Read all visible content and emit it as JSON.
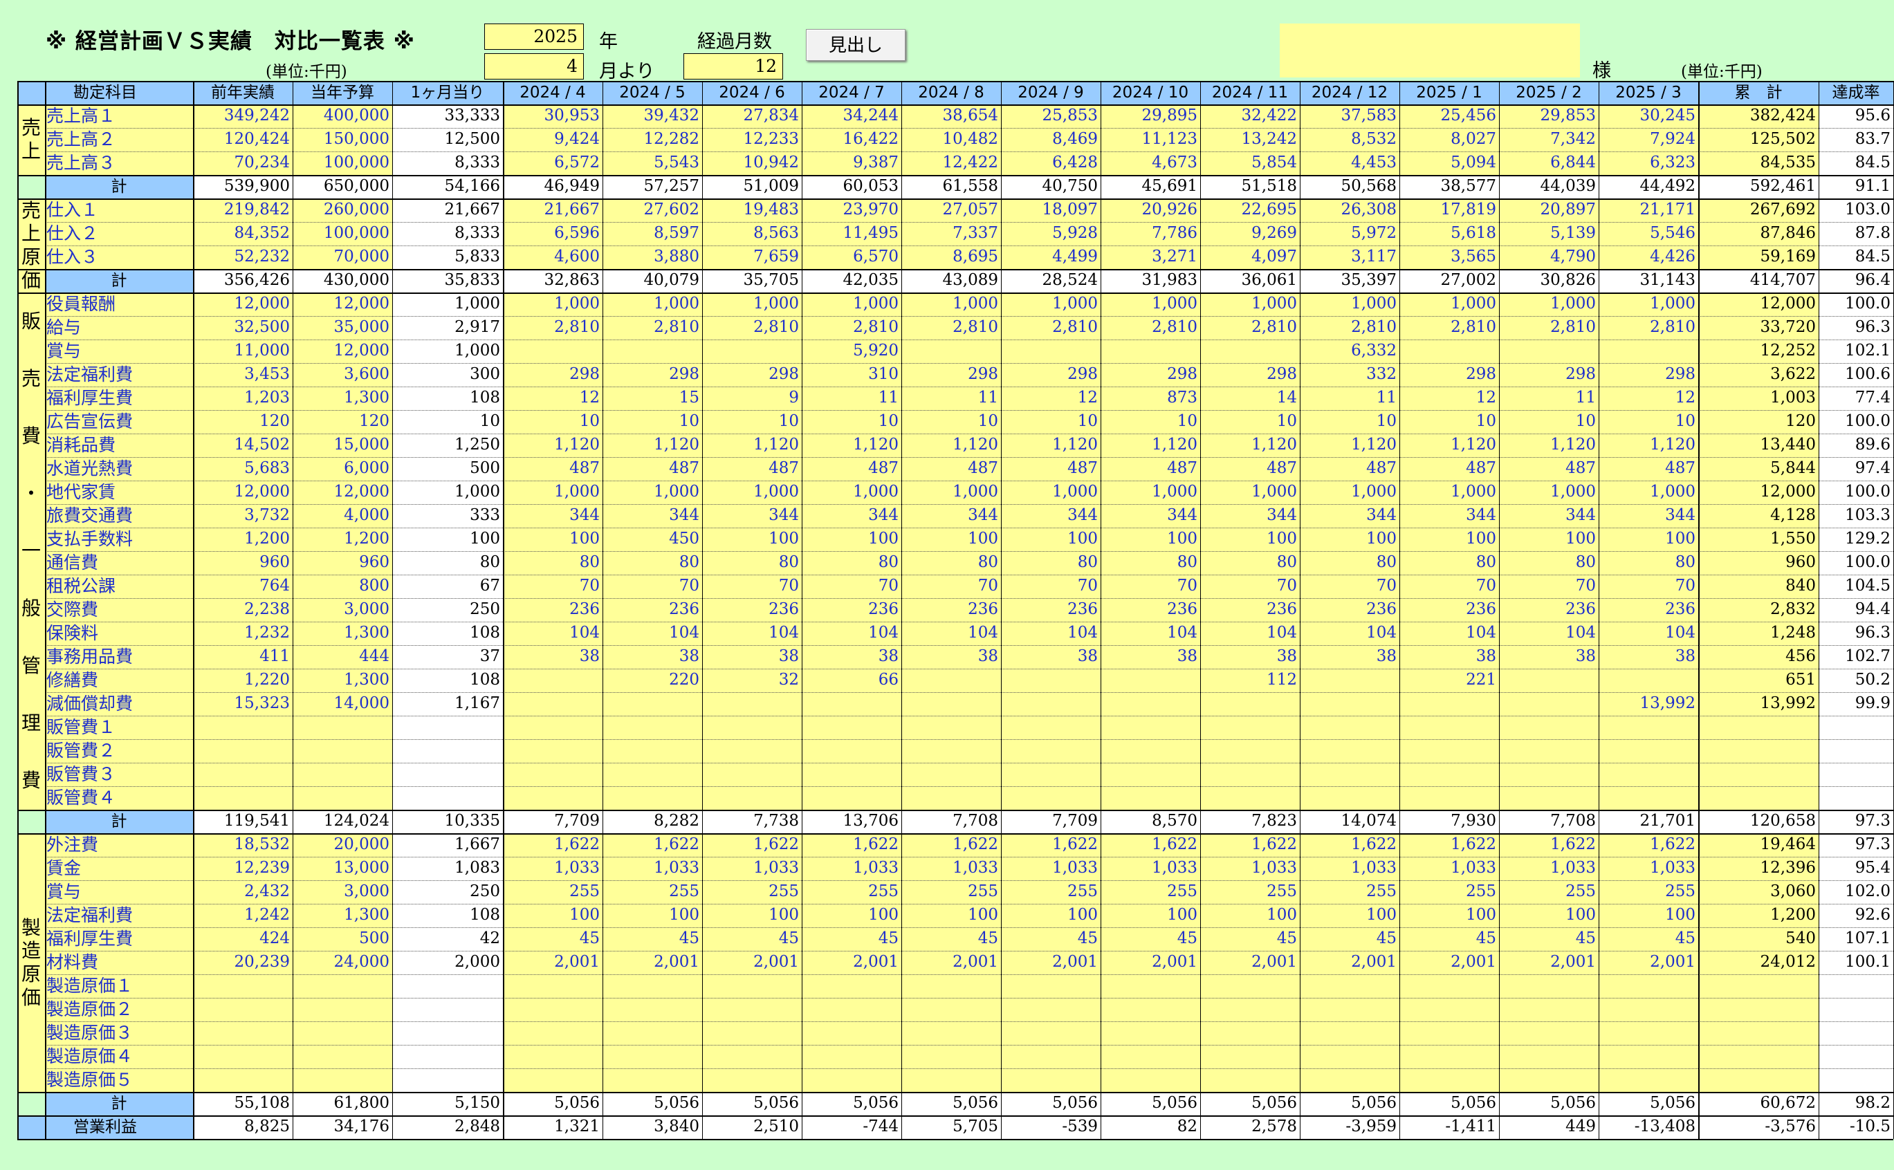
{
  "title": "※ 経営計画ＶＳ実績　対比一覧表 ※",
  "unit_label": "(単位:千円)",
  "controls": {
    "year_value": "2025",
    "year_label": "年",
    "month_value": "4",
    "month_label": "月より",
    "elapsed_label": "経過月数",
    "elapsed_value": "12",
    "heading_button": "見出し"
  },
  "client": {
    "name": "",
    "suffix": "様",
    "unit_label": "(単位:千円)"
  },
  "columns": [
    "勘定科目",
    "前年実績",
    "当年予算",
    "1ヶ月当り",
    "2024 / 4",
    "2024 / 5",
    "2024 / 6",
    "2024 / 7",
    "2024 / 8",
    "2024 / 9",
    "2024 / 10",
    "2024 / 11",
    "2024 / 12",
    "2025 / 1",
    "2025 / 2",
    "2025 / 3",
    "累　計",
    "達成率"
  ],
  "groups": [
    {
      "label": "売上",
      "start": 0,
      "rows": 3
    },
    {
      "label": "売上原価",
      "start": 4,
      "rows": 4
    },
    {
      "label": "販売費・一般管理費",
      "start": 8,
      "rows": 22
    },
    {
      "label": "製造原価",
      "start": 31,
      "rows": 11
    }
  ],
  "rows": [
    {
      "name": "売上高１",
      "vals": [
        "349,242",
        "400,000",
        "33,333",
        "30,953",
        "39,432",
        "27,834",
        "34,244",
        "38,654",
        "25,853",
        "29,895",
        "32,422",
        "37,583",
        "25,456",
        "29,853",
        "30,245",
        "382,424",
        "95.6"
      ]
    },
    {
      "name": "売上高２",
      "vals": [
        "120,424",
        "150,000",
        "12,500",
        "9,424",
        "12,282",
        "12,233",
        "16,422",
        "10,482",
        "8,469",
        "11,123",
        "13,242",
        "8,532",
        "8,027",
        "7,342",
        "7,924",
        "125,502",
        "83.7"
      ]
    },
    {
      "name": "売上高３",
      "vals": [
        "70,234",
        "100,000",
        "8,333",
        "6,572",
        "5,543",
        "10,942",
        "9,387",
        "12,422",
        "6,428",
        "4,673",
        "5,854",
        "4,453",
        "5,094",
        "6,844",
        "6,323",
        "84,535",
        "84.5"
      ]
    },
    {
      "name": "計",
      "total": true,
      "vals": [
        "539,900",
        "650,000",
        "54,166",
        "46,949",
        "57,257",
        "51,009",
        "60,053",
        "61,558",
        "40,750",
        "45,691",
        "51,518",
        "50,568",
        "38,577",
        "44,039",
        "44,492",
        "592,461",
        "91.1"
      ]
    },
    {
      "name": "仕入１",
      "vals": [
        "219,842",
        "260,000",
        "21,667",
        "21,667",
        "27,602",
        "19,483",
        "23,970",
        "27,057",
        "18,097",
        "20,926",
        "22,695",
        "26,308",
        "17,819",
        "20,897",
        "21,171",
        "267,692",
        "103.0"
      ]
    },
    {
      "name": "仕入２",
      "vals": [
        "84,352",
        "100,000",
        "8,333",
        "6,596",
        "8,597",
        "8,563",
        "11,495",
        "7,337",
        "5,928",
        "7,786",
        "9,269",
        "5,972",
        "5,618",
        "5,139",
        "5,546",
        "87,846",
        "87.8"
      ]
    },
    {
      "name": "仕入３",
      "vals": [
        "52,232",
        "70,000",
        "5,833",
        "4,600",
        "3,880",
        "7,659",
        "6,570",
        "8,695",
        "4,499",
        "3,271",
        "4,097",
        "3,117",
        "3,565",
        "4,790",
        "4,426",
        "59,169",
        "84.5"
      ]
    },
    {
      "name": "計",
      "total": true,
      "vals": [
        "356,426",
        "430,000",
        "35,833",
        "32,863",
        "40,079",
        "35,705",
        "42,035",
        "43,089",
        "28,524",
        "31,983",
        "36,061",
        "35,397",
        "27,002",
        "30,826",
        "31,143",
        "414,707",
        "96.4"
      ]
    },
    {
      "name": "役員報酬",
      "vals": [
        "12,000",
        "12,000",
        "1,000",
        "1,000",
        "1,000",
        "1,000",
        "1,000",
        "1,000",
        "1,000",
        "1,000",
        "1,000",
        "1,000",
        "1,000",
        "1,000",
        "1,000",
        "12,000",
        "100.0"
      ]
    },
    {
      "name": "給与",
      "vals": [
        "32,500",
        "35,000",
        "2,917",
        "2,810",
        "2,810",
        "2,810",
        "2,810",
        "2,810",
        "2,810",
        "2,810",
        "2,810",
        "2,810",
        "2,810",
        "2,810",
        "2,810",
        "33,720",
        "96.3"
      ]
    },
    {
      "name": "賞与",
      "vals": [
        "11,000",
        "12,000",
        "1,000",
        "",
        "",
        "",
        "5,920",
        "",
        "",
        "",
        "",
        "6,332",
        "",
        "",
        "",
        "12,252",
        "102.1"
      ]
    },
    {
      "name": "法定福利費",
      "vals": [
        "3,453",
        "3,600",
        "300",
        "298",
        "298",
        "298",
        "310",
        "298",
        "298",
        "298",
        "298",
        "332",
        "298",
        "298",
        "298",
        "3,622",
        "100.6"
      ]
    },
    {
      "name": "福利厚生費",
      "vals": [
        "1,203",
        "1,300",
        "108",
        "12",
        "15",
        "9",
        "11",
        "11",
        "12",
        "873",
        "14",
        "11",
        "12",
        "11",
        "12",
        "1,003",
        "77.4"
      ]
    },
    {
      "name": "広告宣伝費",
      "vals": [
        "120",
        "120",
        "10",
        "10",
        "10",
        "10",
        "10",
        "10",
        "10",
        "10",
        "10",
        "10",
        "10",
        "10",
        "10",
        "120",
        "100.0"
      ]
    },
    {
      "name": "消耗品費",
      "vals": [
        "14,502",
        "15,000",
        "1,250",
        "1,120",
        "1,120",
        "1,120",
        "1,120",
        "1,120",
        "1,120",
        "1,120",
        "1,120",
        "1,120",
        "1,120",
        "1,120",
        "1,120",
        "13,440",
        "89.6"
      ]
    },
    {
      "name": "水道光熱費",
      "vals": [
        "5,683",
        "6,000",
        "500",
        "487",
        "487",
        "487",
        "487",
        "487",
        "487",
        "487",
        "487",
        "487",
        "487",
        "487",
        "487",
        "5,844",
        "97.4"
      ]
    },
    {
      "name": "地代家賃",
      "vals": [
        "12,000",
        "12,000",
        "1,000",
        "1,000",
        "1,000",
        "1,000",
        "1,000",
        "1,000",
        "1,000",
        "1,000",
        "1,000",
        "1,000",
        "1,000",
        "1,000",
        "1,000",
        "12,000",
        "100.0"
      ]
    },
    {
      "name": "旅費交通費",
      "vals": [
        "3,732",
        "4,000",
        "333",
        "344",
        "344",
        "344",
        "344",
        "344",
        "344",
        "344",
        "344",
        "344",
        "344",
        "344",
        "344",
        "4,128",
        "103.3"
      ]
    },
    {
      "name": "支払手数料",
      "vals": [
        "1,200",
        "1,200",
        "100",
        "100",
        "450",
        "100",
        "100",
        "100",
        "100",
        "100",
        "100",
        "100",
        "100",
        "100",
        "100",
        "1,550",
        "129.2"
      ]
    },
    {
      "name": "通信費",
      "vals": [
        "960",
        "960",
        "80",
        "80",
        "80",
        "80",
        "80",
        "80",
        "80",
        "80",
        "80",
        "80",
        "80",
        "80",
        "80",
        "960",
        "100.0"
      ]
    },
    {
      "name": "租税公課",
      "vals": [
        "764",
        "800",
        "67",
        "70",
        "70",
        "70",
        "70",
        "70",
        "70",
        "70",
        "70",
        "70",
        "70",
        "70",
        "70",
        "840",
        "104.5"
      ]
    },
    {
      "name": "交際費",
      "vals": [
        "2,238",
        "3,000",
        "250",
        "236",
        "236",
        "236",
        "236",
        "236",
        "236",
        "236",
        "236",
        "236",
        "236",
        "236",
        "236",
        "2,832",
        "94.4"
      ]
    },
    {
      "name": "保険料",
      "vals": [
        "1,232",
        "1,300",
        "108",
        "104",
        "104",
        "104",
        "104",
        "104",
        "104",
        "104",
        "104",
        "104",
        "104",
        "104",
        "104",
        "1,248",
        "96.3"
      ]
    },
    {
      "name": "事務用品費",
      "vals": [
        "411",
        "444",
        "37",
        "38",
        "38",
        "38",
        "38",
        "38",
        "38",
        "38",
        "38",
        "38",
        "38",
        "38",
        "38",
        "456",
        "102.7"
      ]
    },
    {
      "name": "修繕費",
      "vals": [
        "1,220",
        "1,300",
        "108",
        "",
        "220",
        "32",
        "66",
        "",
        "",
        "",
        "112",
        "",
        "221",
        "",
        "",
        "651",
        "50.2"
      ]
    },
    {
      "name": "減価償却費",
      "vals": [
        "15,323",
        "14,000",
        "1,167",
        "",
        "",
        "",
        "",
        "",
        "",
        "",
        "",
        "",
        "",
        "",
        "13,992",
        "13,992",
        "99.9"
      ]
    },
    {
      "name": "販管費１",
      "vals": [
        "",
        "",
        "",
        "",
        "",
        "",
        "",
        "",
        "",
        "",
        "",
        "",
        "",
        "",
        "",
        "",
        ""
      ]
    },
    {
      "name": "販管費２",
      "vals": [
        "",
        "",
        "",
        "",
        "",
        "",
        "",
        "",
        "",
        "",
        "",
        "",
        "",
        "",
        "",
        "",
        ""
      ]
    },
    {
      "name": "販管費３",
      "vals": [
        "",
        "",
        "",
        "",
        "",
        "",
        "",
        "",
        "",
        "",
        "",
        "",
        "",
        "",
        "",
        "",
        ""
      ]
    },
    {
      "name": "販管費４",
      "vals": [
        "",
        "",
        "",
        "",
        "",
        "",
        "",
        "",
        "",
        "",
        "",
        "",
        "",
        "",
        "",
        "",
        ""
      ]
    },
    {
      "name": "計",
      "total": true,
      "vals": [
        "119,541",
        "124,024",
        "10,335",
        "7,709",
        "8,282",
        "7,738",
        "13,706",
        "7,708",
        "7,709",
        "8,570",
        "7,823",
        "14,074",
        "7,930",
        "7,708",
        "21,701",
        "120,658",
        "97.3"
      ]
    },
    {
      "name": "外注費",
      "vals": [
        "18,532",
        "20,000",
        "1,667",
        "1,622",
        "1,622",
        "1,622",
        "1,622",
        "1,622",
        "1,622",
        "1,622",
        "1,622",
        "1,622",
        "1,622",
        "1,622",
        "1,622",
        "19,464",
        "97.3"
      ]
    },
    {
      "name": "賃金",
      "vals": [
        "12,239",
        "13,000",
        "1,083",
        "1,033",
        "1,033",
        "1,033",
        "1,033",
        "1,033",
        "1,033",
        "1,033",
        "1,033",
        "1,033",
        "1,033",
        "1,033",
        "1,033",
        "12,396",
        "95.4"
      ]
    },
    {
      "name": "賞与",
      "vals": [
        "2,432",
        "3,000",
        "250",
        "255",
        "255",
        "255",
        "255",
        "255",
        "255",
        "255",
        "255",
        "255",
        "255",
        "255",
        "255",
        "3,060",
        "102.0"
      ]
    },
    {
      "name": "法定福利費",
      "vals": [
        "1,242",
        "1,300",
        "108",
        "100",
        "100",
        "100",
        "100",
        "100",
        "100",
        "100",
        "100",
        "100",
        "100",
        "100",
        "100",
        "1,200",
        "92.6"
      ]
    },
    {
      "name": "福利厚生費",
      "vals": [
        "424",
        "500",
        "42",
        "45",
        "45",
        "45",
        "45",
        "45",
        "45",
        "45",
        "45",
        "45",
        "45",
        "45",
        "45",
        "540",
        "107.1"
      ]
    },
    {
      "name": "材料費",
      "vals": [
        "20,239",
        "24,000",
        "2,000",
        "2,001",
        "2,001",
        "2,001",
        "2,001",
        "2,001",
        "2,001",
        "2,001",
        "2,001",
        "2,001",
        "2,001",
        "2,001",
        "2,001",
        "24,012",
        "100.1"
      ]
    },
    {
      "name": "製造原価１",
      "vals": [
        "",
        "",
        "",
        "",
        "",
        "",
        "",
        "",
        "",
        "",
        "",
        "",
        "",
        "",
        "",
        "",
        ""
      ]
    },
    {
      "name": "製造原価２",
      "vals": [
        "",
        "",
        "",
        "",
        "",
        "",
        "",
        "",
        "",
        "",
        "",
        "",
        "",
        "",
        "",
        "",
        ""
      ]
    },
    {
      "name": "製造原価３",
      "vals": [
        "",
        "",
        "",
        "",
        "",
        "",
        "",
        "",
        "",
        "",
        "",
        "",
        "",
        "",
        "",
        "",
        ""
      ]
    },
    {
      "name": "製造原価４",
      "vals": [
        "",
        "",
        "",
        "",
        "",
        "",
        "",
        "",
        "",
        "",
        "",
        "",
        "",
        "",
        "",
        "",
        ""
      ]
    },
    {
      "name": "製造原価５",
      "vals": [
        "",
        "",
        "",
        "",
        "",
        "",
        "",
        "",
        "",
        "",
        "",
        "",
        "",
        "",
        "",
        "",
        ""
      ]
    },
    {
      "name": "計",
      "total": true,
      "vals": [
        "55,108",
        "61,800",
        "5,150",
        "5,056",
        "5,056",
        "5,056",
        "5,056",
        "5,056",
        "5,056",
        "5,056",
        "5,056",
        "5,056",
        "5,056",
        "5,056",
        "5,056",
        "60,672",
        "98.2"
      ]
    },
    {
      "name": "営業利益",
      "total": true,
      "span": true,
      "vals": [
        "8,825",
        "34,176",
        "2,848",
        "1,321",
        "3,840",
        "2,510",
        "-744",
        "5,705",
        "-539",
        "82",
        "2,578",
        "-3,959",
        "-1,411",
        "449",
        "-13,408",
        "-3,576",
        "-10.5"
      ]
    }
  ]
}
